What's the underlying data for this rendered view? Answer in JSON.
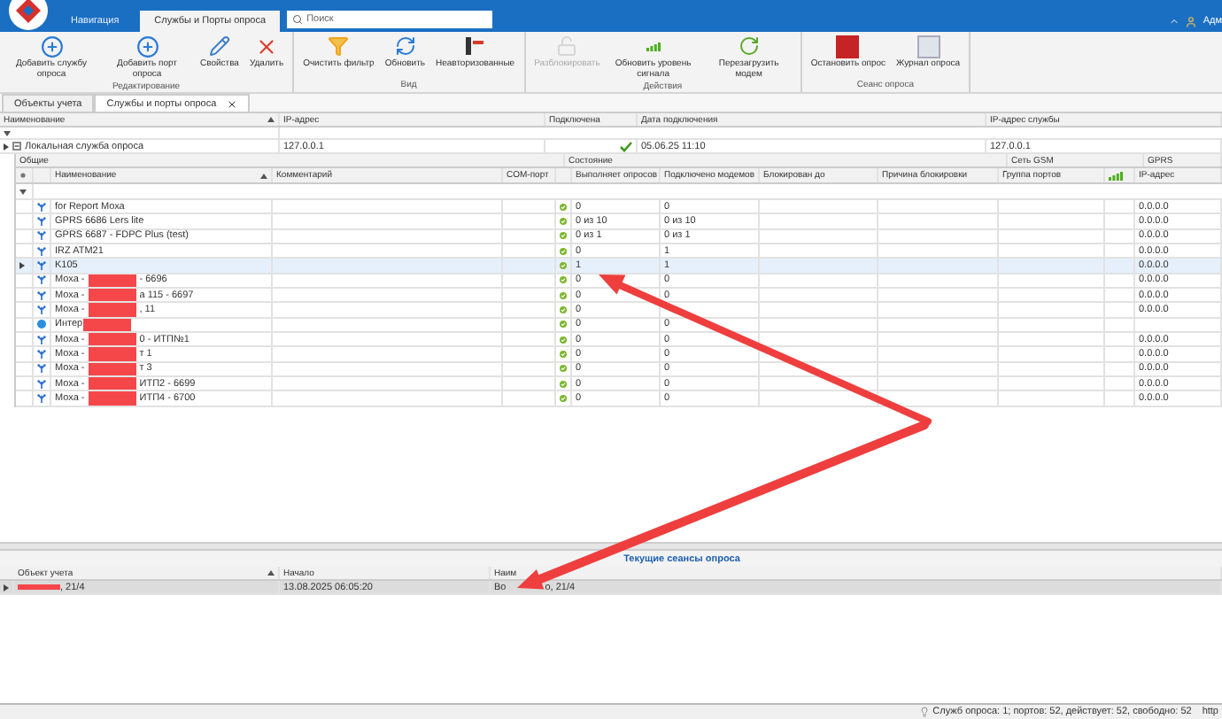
{
  "app": {
    "tabs": [
      {
        "label": "Навигация",
        "selected": false
      },
      {
        "label": "Службы и Порты опроса",
        "selected": true
      }
    ],
    "search": {
      "placeholder": "Поиск"
    },
    "user": "Адм"
  },
  "ribbon": {
    "groups": [
      {
        "label": "Редактирование",
        "buttons": [
          {
            "label": "Добавить службу опроса",
            "disabled": false
          },
          {
            "label": "Добавить порт опроса",
            "disabled": false
          },
          {
            "label": "Свойства",
            "disabled": false
          },
          {
            "label": "Удалить",
            "disabled": false
          }
        ]
      },
      {
        "label": "Вид",
        "buttons": [
          {
            "label": "Очистить фильтр",
            "disabled": false
          },
          {
            "label": "Обновить",
            "disabled": false
          },
          {
            "label": "Неавторизованные",
            "disabled": false
          }
        ]
      },
      {
        "label": "Действия",
        "buttons": [
          {
            "label": "Разблокировать",
            "disabled": true
          },
          {
            "label": "Обновить уровень сигнала",
            "disabled": false
          },
          {
            "label": "Перезагрузить модем",
            "disabled": false
          }
        ]
      },
      {
        "label": "Сеанс опроса",
        "buttons": [
          {
            "label": "Остановить опрос",
            "disabled": false
          },
          {
            "label": "Журнал опроса",
            "disabled": false
          }
        ]
      }
    ]
  },
  "doc_tabs": [
    {
      "label": "Объекты учета",
      "selected": false
    },
    {
      "label": "Службы и порты опроса",
      "selected": true
    }
  ],
  "services_table": {
    "columns": [
      "Наименование",
      "IP-адрес",
      "Подключена",
      "Дата подключения",
      "IP-адрес службы"
    ],
    "rows": [
      {
        "name": "Локальная служба опроса",
        "ip": "127.0.0.1",
        "connected": true,
        "date": "05.06.25 11:10",
        "service_ip": "127.0.0.1",
        "expanded": true
      }
    ]
  },
  "ports_table": {
    "bands": [
      "Общие",
      "Состояние",
      "Сеть GSM",
      "GPRS"
    ],
    "columns": [
      "Наименование",
      "Комментарий",
      "COM-порт",
      "Выполняет опросов",
      "Подключено модемов",
      "Блокирован до",
      "Причина блокировки",
      "Группа портов",
      "IP-адрес"
    ],
    "rows": [
      {
        "kind": "modem",
        "name": "for Report Моха",
        "polls": "0",
        "modems": "0",
        "ip": "0.0.0.0",
        "selected": false,
        "redacted": false
      },
      {
        "kind": "modem",
        "name": "GPRS 6686 Lers lite",
        "polls": "0 из 10",
        "modems": "0 из 10",
        "ip": "0.0.0.0",
        "selected": false,
        "redacted": false
      },
      {
        "kind": "modem",
        "name": "GPRS 6687 - FDPC Plus (test)",
        "polls": "0 из 1",
        "modems": "0 из 1",
        "ip": "0.0.0.0",
        "selected": false,
        "redacted": false
      },
      {
        "kind": "modem",
        "name": "IRZ ATM21",
        "polls": "0",
        "modems": "1",
        "ip": "0.0.0.0",
        "selected": false,
        "redacted": false
      },
      {
        "kind": "modem",
        "name": "K105",
        "polls": "1",
        "modems": "1",
        "ip": "0.0.0.0",
        "selected": true,
        "redacted": false
      },
      {
        "kind": "modem",
        "name": "Моха -",
        "name_end": "- 6696",
        "polls": "0",
        "modems": "0",
        "ip": "0.0.0.0",
        "selected": false,
        "redacted": true
      },
      {
        "kind": "modem",
        "name": "Моха -",
        "name_end": "а 115 - 6697",
        "polls": "0",
        "modems": "0",
        "ip": "0.0.0.0",
        "selected": false,
        "redacted": true
      },
      {
        "kind": "modem",
        "name": "Моха -",
        "name_end": ", 11",
        "polls": "0",
        "ip": "0.0.0.0",
        "selected": false,
        "redacted": true
      },
      {
        "kind": "internet",
        "name": "Интер",
        "polls": "0",
        "modems": "0",
        "selected": false,
        "redacted": true
      },
      {
        "kind": "modem",
        "name": "Моха -",
        "name_end": "0 - ИТП№1",
        "polls": "0",
        "modems": "0",
        "ip": "0.0.0.0",
        "selected": false,
        "redacted": true
      },
      {
        "kind": "modem",
        "name": "Моха -",
        "name_end": "т 1",
        "polls": "0",
        "modems": "0",
        "ip": "0.0.0.0",
        "selected": false,
        "redacted": true
      },
      {
        "kind": "modem",
        "name": "Моха -",
        "name_end": "т 3",
        "polls": "0",
        "modems": "0",
        "ip": "0.0.0.0",
        "selected": false,
        "redacted": true
      },
      {
        "kind": "modem",
        "name": "Моха -",
        "name_end": "ИТП2 - 6699",
        "polls": "0",
        "modems": "0",
        "ip": "0.0.0.0",
        "selected": false,
        "redacted": true
      },
      {
        "kind": "modem",
        "name": "Моха -",
        "name_end": "ИТП4 - 6700",
        "polls": "0",
        "modems": "0",
        "ip": "0.0.0.0",
        "selected": false,
        "redacted": true
      }
    ]
  },
  "sessions": {
    "title": "Текущие сеансы опроса",
    "columns": [
      "Объект учета",
      "Начало",
      "Наим"
    ],
    "rows": [
      {
        "object": ", 21/4",
        "start": "13.08.2025 06:05:20",
        "name": "Во",
        "name_end": "о, 21/4",
        "redacted": true
      }
    ]
  },
  "status_bar": {
    "text": "Служб опроса: 1; портов: 52, действует: 52, свободно: 52",
    "link": "http"
  }
}
